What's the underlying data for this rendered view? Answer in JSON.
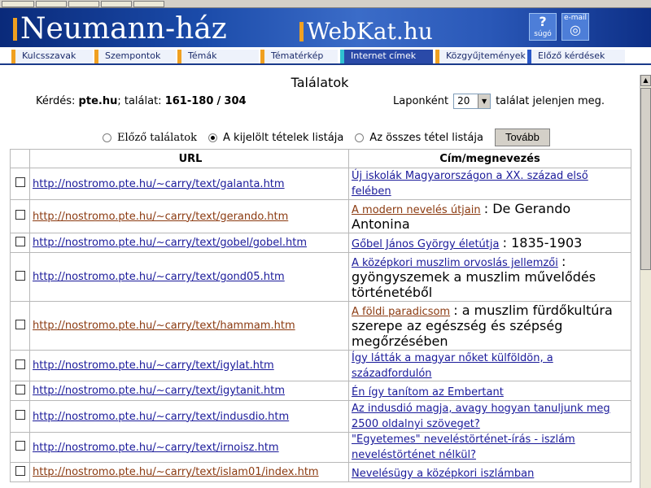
{
  "header": {
    "brand_left": "Neumann-ház",
    "brand_right": "WebKat.hu",
    "help_label": "súgó",
    "email_label": "e-mail"
  },
  "nav": [
    {
      "label": "Kulcsszavak"
    },
    {
      "label": "Szempontok"
    },
    {
      "label": "Témák"
    },
    {
      "label": "Tématérkép"
    },
    {
      "label": "Internet címek"
    },
    {
      "label": "Közgyűjtemények"
    },
    {
      "label": "Előző kérdések"
    }
  ],
  "page": {
    "title": "Találatok",
    "query_label": "Kérdés:",
    "query_value": "pte.hu",
    "hits_label": "; találat:",
    "hits_range": "161-180",
    "hits_sep": "/",
    "hits_total": "304",
    "perpage_before": "Laponként",
    "perpage_value": "20",
    "perpage_after": "találat jelenjen meg."
  },
  "radios": [
    {
      "label": "Előző találatok",
      "checked": false
    },
    {
      "label": "A kijelölt tételek listája",
      "checked": true
    },
    {
      "label": "Az összes tétel listája",
      "checked": false
    }
  ],
  "next_button": "Tovább",
  "table": {
    "col_url": "URL",
    "col_title": "Cím/megnevezés",
    "rows": [
      {
        "url": "http://nostromo.pte.hu/~carry/text/galanta.htm",
        "visited": false,
        "link": "Új iskolák Magyarországon a XX. század első felében",
        "rest": ""
      },
      {
        "url": "http://nostromo.pte.hu/~carry/text/gerando.htm",
        "visited": true,
        "link": "A modern nevelés útjain",
        "rest": ": De Gerando Antonina"
      },
      {
        "url": "http://nostromo.pte.hu/~carry/text/gobel/gobel.htm",
        "visited": false,
        "link": "Gőbel János György életútja",
        "rest": ": 1835-1903"
      },
      {
        "url": "http://nostromo.pte.hu/~carry/text/gond05.htm",
        "visited": false,
        "link": "A középkori muszlim orvoslás jellemzői",
        "rest": ": gyöngyszemek a muszlim művelődés történetéből"
      },
      {
        "url": "http://nostromo.pte.hu/~carry/text/hammam.htm",
        "visited": true,
        "link": "A földi paradicsom",
        "rest": ": a muszlim fürdőkultúra szerepe az egészség és szépség megőrzésében"
      },
      {
        "url": "http://nostromo.pte.hu/~carry/text/igylat.htm",
        "visited": false,
        "link": "Így látták a magyar nőket külföldön, a századfordulón",
        "rest": ""
      },
      {
        "url": "http://nostromo.pte.hu/~carry/text/igytanit.htm",
        "visited": false,
        "link": "Én így tanítom az Embertant",
        "rest": ""
      },
      {
        "url": "http://nostromo.pte.hu/~carry/text/indusdio.htm",
        "visited": false,
        "link": "Az indusdió magja, avagy hogyan tanuljunk meg 2500 oldalnyi szöveget?",
        "rest": ""
      },
      {
        "url": "http://nostromo.pte.hu/~carry/text/irnoisz.htm",
        "visited": false,
        "link": "\"Egyetemes\" neveléstörténet-írás - iszlám neveléstörténet nélkül?",
        "rest": ""
      },
      {
        "url": "http://nostromo.pte.hu/~carry/text/islam01/index.htm",
        "visited": true,
        "link": "Nevelésügy a középkori iszlámban",
        "rest": ""
      }
    ]
  }
}
